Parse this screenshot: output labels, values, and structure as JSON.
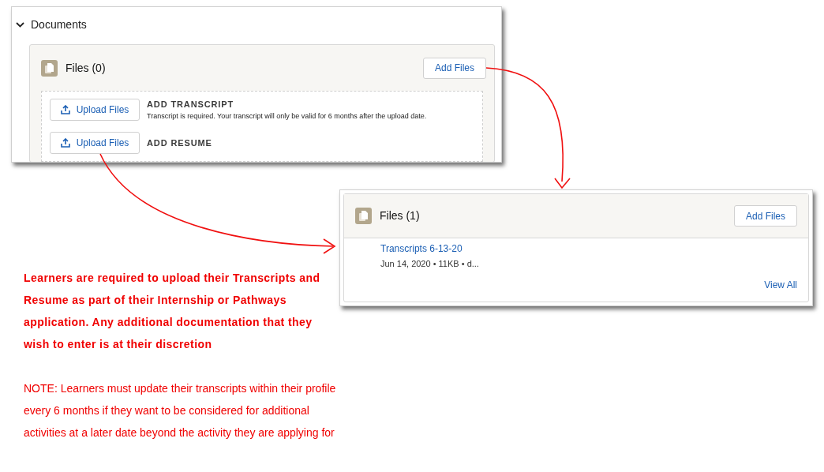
{
  "documents_panel": {
    "section_title": "Documents",
    "expanded": true,
    "files_card": {
      "title": "Files (0)",
      "add_button": "Add Files",
      "uploads": [
        {
          "button": "Upload Files",
          "label": "ADD TRANSCRIPT",
          "description": "Transcript is required. Your transcript will only be valid for 6 months after the upload date."
        },
        {
          "button": "Upload Files",
          "label": "ADD RESUME"
        }
      ]
    }
  },
  "files_panel": {
    "title": "Files (1)",
    "add_button": "Add Files",
    "files": [
      {
        "name": "Transcripts 6-13-20",
        "meta": "Jun 14, 2020 • 11KB • d..."
      }
    ],
    "view_all": "View All"
  },
  "notes": [
    {
      "kind": "bold",
      "text": "Learners are required to upload their Transcripts and Resume as part of their Internship or Pathways application. Any additional documentation that they wish to enter is at their discretion"
    },
    {
      "kind": "plain",
      "text": "NOTE: Learners must update their transcripts within their profile every 6 months if they want to be considered for additional activities at a later date beyond the activity they are applying for"
    }
  ]
}
